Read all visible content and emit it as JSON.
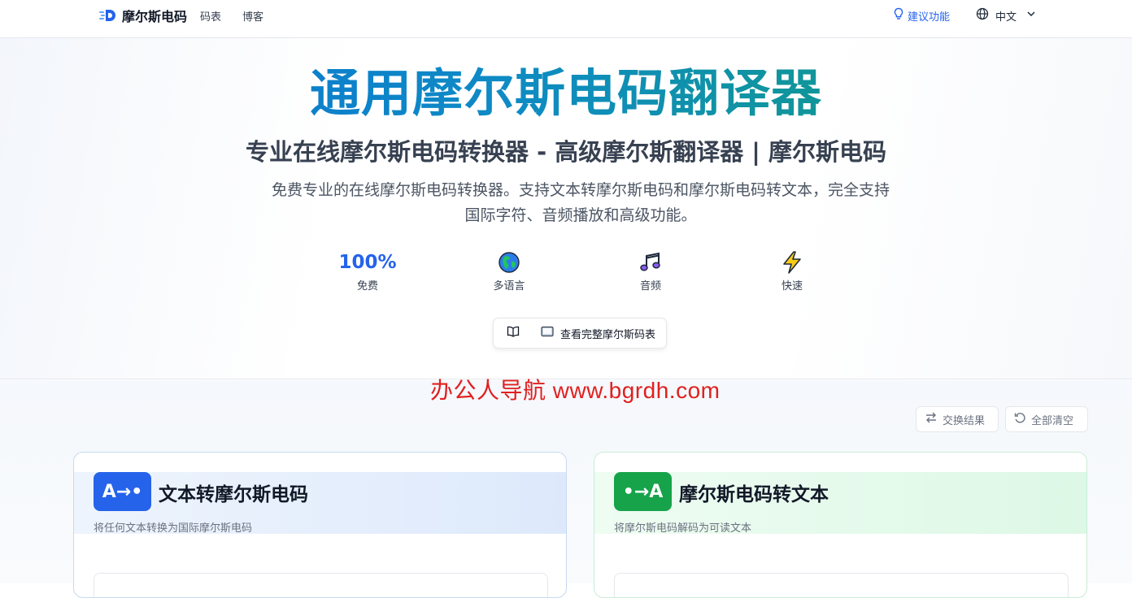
{
  "header": {
    "logo_text": "摩尔斯电码",
    "nav": [
      {
        "label": "码表"
      },
      {
        "label": "博客"
      }
    ],
    "suggest_label": "建议功能",
    "language_label": "中文"
  },
  "hero": {
    "title": "通用摩尔斯电码翻译器",
    "subtitle": "专业在线摩尔斯电码转换器 - 高级摩尔斯翻译器 | 摩尔斯电码",
    "description": "免费专业的在线摩尔斯电码转换器。支持文本转摩尔斯电码和摩尔斯电码转文本，完全支持国际字符、音频播放和高级功能。",
    "features": [
      {
        "value": "100%",
        "label": "免费",
        "icon": "percent-text"
      },
      {
        "label": "多语言",
        "icon": "globe-icon"
      },
      {
        "label": "音频",
        "icon": "music-note-icon"
      },
      {
        "label": "快速",
        "icon": "lightning-icon"
      }
    ],
    "table_button_label": "查看完整摩尔斯码表"
  },
  "watermark": "办公人导航  www.bgrdh.com",
  "controls": {
    "swap_label": "交换结果",
    "clear_label": "全部清空"
  },
  "panels": {
    "text_to_morse": {
      "badge": "A→•",
      "title": "文本转摩尔斯电码",
      "description": "将任何文本转换为国际摩尔斯电码"
    },
    "morse_to_text": {
      "badge": "•→A",
      "title": "摩尔斯电码转文本",
      "description": "将摩尔斯电码解码为可读文本"
    }
  },
  "colors": {
    "accent_blue": "#2563eb",
    "accent_green": "#16a34a",
    "title_gradient_start": "#0b6fd6",
    "title_gradient_end": "#12a06e"
  }
}
